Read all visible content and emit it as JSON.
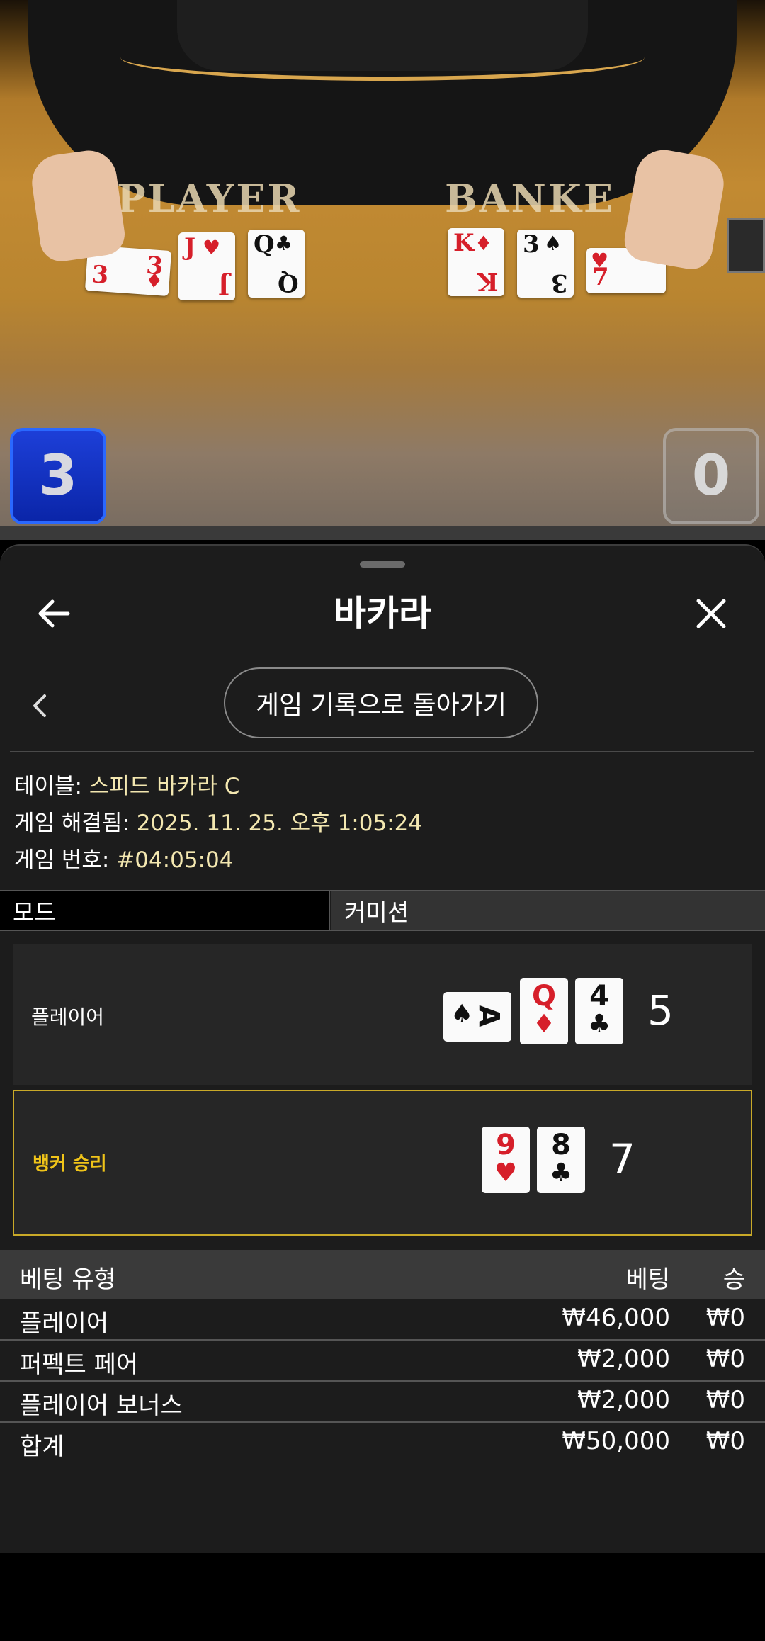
{
  "video": {
    "felt_player_label": "PLAYER",
    "felt_banker_label": "BANKE",
    "player_score": "3",
    "banker_score": "0"
  },
  "sheet": {
    "title": "바카라",
    "history_button": "게임 기록으로 돌아가기",
    "info": {
      "table_label": "테이블:",
      "table_value": "스피드 바카라 C",
      "resolved_label": "게임 해결됨:",
      "resolved_value": "2025. 11. 25. 오후 1:05:24",
      "number_label": "게임 번호:",
      "number_value": "#04:05:04"
    },
    "tabs": {
      "mode": "모드",
      "commission": "커미션"
    }
  },
  "result": {
    "player": {
      "label": "플레이어",
      "cards": [
        {
          "rank": "A",
          "suit": "♠",
          "color": "#111111"
        },
        {
          "rank": "Q",
          "suit": "♦",
          "color": "#d61f2a"
        },
        {
          "rank": "4",
          "suit": "♣",
          "color": "#111111"
        }
      ],
      "total": "5"
    },
    "banker": {
      "label": "뱅커 승리",
      "label_color": "#f0c419",
      "cards": [
        {
          "rank": "9",
          "suit": "♥",
          "color": "#d61f2a"
        },
        {
          "rank": "8",
          "suit": "♣",
          "color": "#111111"
        }
      ],
      "total": "7"
    }
  },
  "bets": {
    "headers": {
      "type": "베팅 유형",
      "bet": "베팅",
      "win": "승"
    },
    "rows": [
      {
        "type": "플레이어",
        "bet": "₩46,000",
        "win": "₩0"
      },
      {
        "type": "퍼펙트 페어",
        "bet": "₩2,000",
        "win": "₩0"
      },
      {
        "type": "플레이어 보너스",
        "bet": "₩2,000",
        "win": "₩0"
      },
      {
        "type": "합계",
        "bet": "₩50,000",
        "win": "₩0"
      }
    ]
  },
  "colors": {
    "accent_gold": "#c9a928",
    "player_blue": "#1d3fd8",
    "sheet_bg": "#1c1c1c"
  }
}
